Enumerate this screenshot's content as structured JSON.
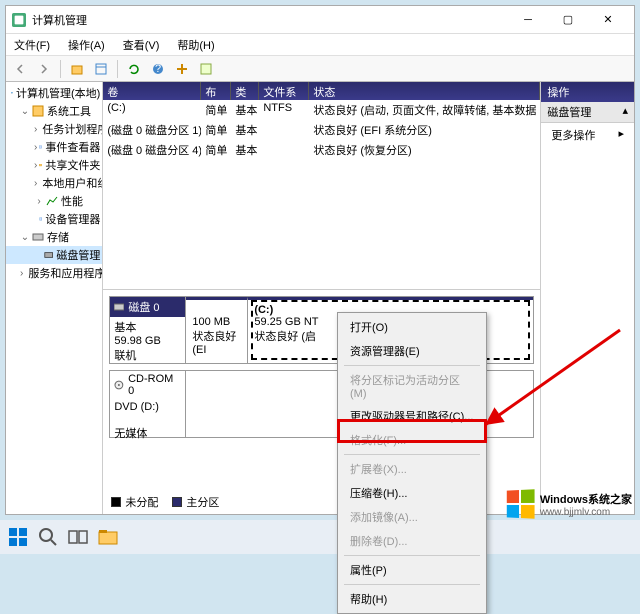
{
  "window": {
    "title": "计算机管理"
  },
  "menubar": {
    "file": "文件(F)",
    "action": "操作(A)",
    "view": "查看(V)",
    "help": "帮助(H)"
  },
  "tree": {
    "root": "计算机管理(本地)",
    "sys_tools": "系统工具",
    "task_sched": "任务计划程序",
    "event_viewer": "事件查看器",
    "shared": "共享文件夹",
    "local_users": "本地用户和组",
    "perf": "性能",
    "dev_mgr": "设备管理器",
    "storage": "存储",
    "disk_mgmt": "磁盘管理",
    "services": "服务和应用程序"
  },
  "list": {
    "col_vol": "卷",
    "col_layout": "布局",
    "col_type": "类型",
    "col_fs": "文件系统",
    "col_status": "状态",
    "rows": [
      {
        "vol": "(C:)",
        "layout": "简单",
        "type": "基本",
        "fs": "NTFS",
        "status": "状态良好 (启动, 页面文件, 故障转储, 基本数据"
      },
      {
        "vol": "(磁盘 0 磁盘分区 1)",
        "layout": "简单",
        "type": "基本",
        "fs": "",
        "status": "状态良好 (EFI 系统分区)"
      },
      {
        "vol": "(磁盘 0 磁盘分区 4)",
        "layout": "简单",
        "type": "基本",
        "fs": "",
        "status": "状态良好 (恢复分区)"
      }
    ]
  },
  "disks": {
    "d0": {
      "name": "磁盘 0",
      "type": "基本",
      "size": "59.98 GB",
      "state": "联机",
      "p1_size": "100 MB",
      "p1_status": "状态良好 (EI",
      "p2_name": "(C:)",
      "p2_size": "59.25 GB NT",
      "p2_status": "状态良好 (启"
    },
    "cd": {
      "name": "CD-ROM 0",
      "label": "DVD (D:)",
      "state": "无媒体"
    }
  },
  "legend": {
    "unalloc": "未分配",
    "primary": "主分区"
  },
  "actions": {
    "title": "操作",
    "section": "磁盘管理",
    "more": "更多操作"
  },
  "ctx": {
    "open": "打开(O)",
    "explorer": "资源管理器(E)",
    "mark_active": "将分区标记为活动分区(M)",
    "change_letter": "更改驱动器号和路径(C)...",
    "format": "格式化(F)...",
    "extend": "扩展卷(X)...",
    "shrink": "压缩卷(H)...",
    "add_mirror": "添加镜像(A)...",
    "delete": "删除卷(D)...",
    "properties": "属性(P)",
    "help": "帮助(H)"
  },
  "watermark": {
    "main": "Windows系统之家",
    "sub": "www.bjjmlv.com"
  }
}
